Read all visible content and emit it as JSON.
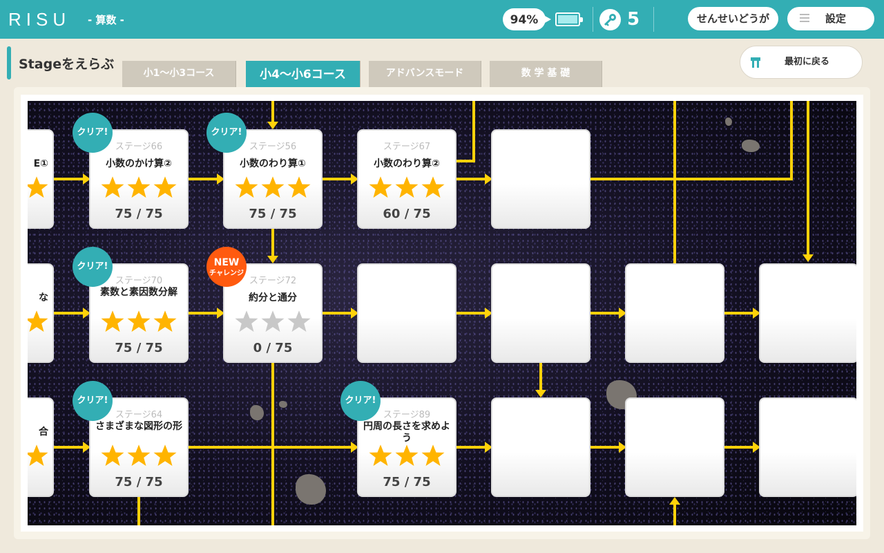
{
  "header": {
    "logo": "RISU",
    "subject": "- 算数 -",
    "battery_percent": "94%",
    "key_count": "5",
    "teacher_video_label": "せんせいどうが",
    "settings_label": "設定"
  },
  "stage_select": {
    "title": "Stageをえらぶ",
    "tabs": [
      {
        "label": "小1〜小3コース",
        "active": false
      },
      {
        "label": "小4〜小6コース",
        "active": true
      },
      {
        "label": "アドバンスモード",
        "active": false
      },
      {
        "label": "数 学 基 礎",
        "active": false
      }
    ],
    "back_label": "最初に戻る"
  },
  "badges": {
    "clear": "クリア!",
    "new_line1": "NEW",
    "new_line2": "チャレンジ"
  },
  "partial_cards": [
    {
      "title_fragment": "E①"
    },
    {
      "title_fragment": "な"
    },
    {
      "title_fragment": "合"
    }
  ],
  "cards": [
    {
      "stage": "ステージ66",
      "title": "小数のかけ算②",
      "stars": 3,
      "score": "75 / 75",
      "badge": "clear"
    },
    {
      "stage": "ステージ56",
      "title": "小数のわり算①",
      "stars": 3,
      "score": "75 / 75",
      "badge": "clear"
    },
    {
      "stage": "ステージ67",
      "title": "小数のわり算②",
      "stars": 3,
      "score": "60 / 75",
      "badge": null
    },
    {
      "stage": "ステージ70",
      "title": "素数と素因数分解",
      "stars": 3,
      "score": "75 / 75",
      "badge": "clear"
    },
    {
      "stage": "ステージ72",
      "title": "約分と通分",
      "stars": 0,
      "score": "0 / 75",
      "badge": "new"
    },
    {
      "stage": "ステージ64",
      "title": "さまざまな図形の形",
      "stars": 3,
      "score": "75 / 75",
      "badge": "clear"
    },
    {
      "stage": "ステージ89",
      "title": "円周の長さを求めよう",
      "stars": 3,
      "score": "75 / 75",
      "badge": "clear"
    }
  ],
  "colors": {
    "teal": "#33aeb4",
    "path_yellow": "#ffd20a",
    "star_gold": "#ffb400",
    "star_empty": "#c8c8c8",
    "new_orange": "#ff5a0f"
  }
}
